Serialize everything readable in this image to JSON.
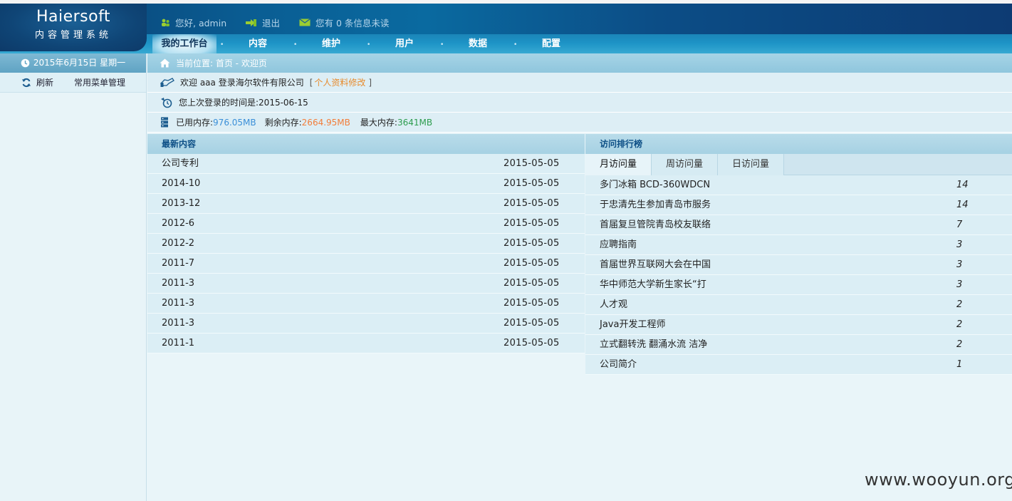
{
  "logo": {
    "brand": "Haiersoft",
    "subtitle": "内容管理系统"
  },
  "header": {
    "greeting": "您好, admin",
    "logout": "退出",
    "messages": "您有 0 条信息未读"
  },
  "nav": {
    "items": [
      "我的工作台",
      "内容",
      "维护",
      "用户",
      "数据",
      "配置"
    ],
    "active_index": 0
  },
  "sidebar": {
    "date": "2015年6月15日 星期一",
    "refresh": "刷新",
    "menu_manage": "常用菜单管理"
  },
  "breadcrumb": "当前位置: 首页 - 欢迎页",
  "welcome": {
    "text": "欢迎 aaa  登录海尔软件有限公司",
    "bracket_open": "[",
    "profile_link": "个人资料修改",
    "bracket_close": "]"
  },
  "last_login": {
    "label": "您上次登录的时间是:",
    "value": "2015-06-15"
  },
  "memory": {
    "used_label": "已用内存:",
    "used": "976.05MB",
    "free_label": "剩余内存:",
    "free": "2664.95MB",
    "max_label": "最大内存:",
    "max": "3641MB"
  },
  "latest": {
    "title": "最新内容",
    "rows": [
      {
        "title": "公司专利",
        "date": "2015-05-05"
      },
      {
        "title": "2014-10",
        "date": "2015-05-05"
      },
      {
        "title": "2013-12",
        "date": "2015-05-05"
      },
      {
        "title": "2012-6",
        "date": "2015-05-05"
      },
      {
        "title": "2012-2",
        "date": "2015-05-05"
      },
      {
        "title": "2011-7",
        "date": "2015-05-05"
      },
      {
        "title": "2011-3",
        "date": "2015-05-05"
      },
      {
        "title": "2011-3",
        "date": "2015-05-05"
      },
      {
        "title": "2011-3",
        "date": "2015-05-05"
      },
      {
        "title": "2011-1",
        "date": "2015-05-05"
      }
    ]
  },
  "ranking": {
    "title": "访问排行榜",
    "tabs": [
      "月访问量",
      "周访问量",
      "日访问量"
    ],
    "active_tab": 0,
    "rows": [
      {
        "title": "多门冰箱 BCD-360WDCN",
        "count": "14"
      },
      {
        "title": "于忠清先生参加青岛市服务",
        "count": "14"
      },
      {
        "title": "首届复旦管院青岛校友联络",
        "count": "7"
      },
      {
        "title": "应聘指南",
        "count": "3"
      },
      {
        "title": "首届世界互联网大会在中国",
        "count": "3"
      },
      {
        "title": "华中师范大学新生家长“打",
        "count": "3"
      },
      {
        "title": "人才观",
        "count": "2"
      },
      {
        "title": "Java开发工程师",
        "count": "2"
      },
      {
        "title": "立式翻转洗 翻涌水流 洁净",
        "count": "2"
      },
      {
        "title": "公司简介",
        "count": "1"
      }
    ]
  },
  "watermark": "www.wooyun.org"
}
